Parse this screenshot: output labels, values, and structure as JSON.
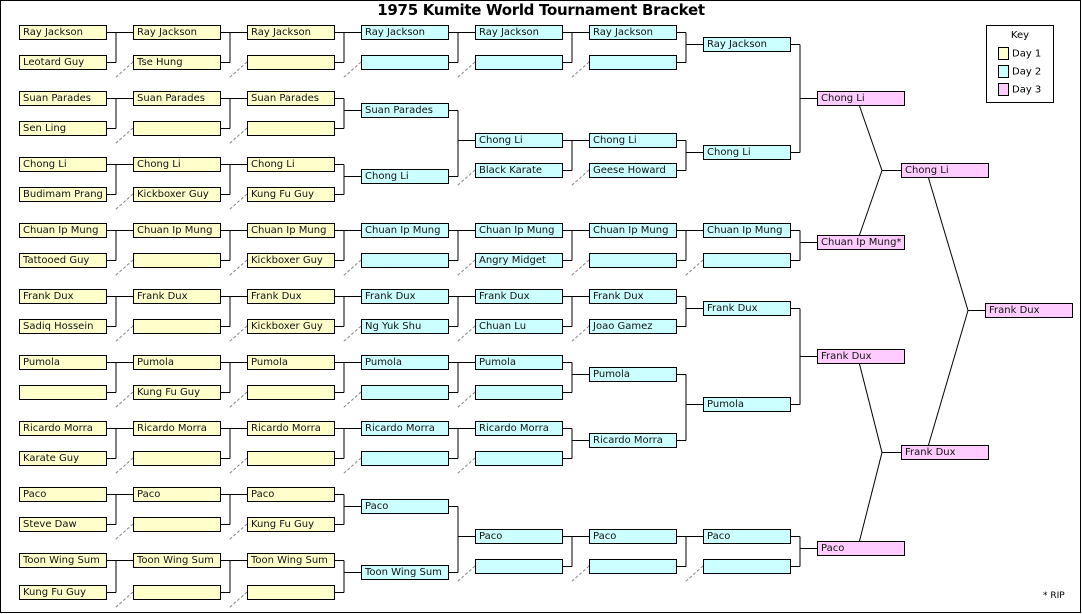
{
  "title": "1975 Kumite World Tournament Bracket",
  "colors": {
    "day1": "#ffffcc",
    "day2": "#ccffff",
    "day3": "#ffccff",
    "line": "#000000",
    "dashed": "#888888"
  },
  "key": {
    "title": "Key",
    "items": [
      {
        "label": "Day 1",
        "day": 1
      },
      {
        "label": "Day 2",
        "day": 2
      },
      {
        "label": "Day 3",
        "day": 3
      }
    ]
  },
  "footnote": "* RIP",
  "rounds": [
    [
      "Ray Jackson",
      "Leotard Guy",
      "Suan Parades",
      "Sen Ling",
      "Chong Li",
      "Budimam Prang",
      "Chuan Ip Mung",
      "Tattooed Guy",
      "Frank Dux",
      "Sadiq Hossein",
      "Pumola",
      "",
      "Ricardo Morra",
      "Karate Guy",
      "Paco",
      "Steve Daw",
      "Toon Wing Sum",
      "Kung Fu Guy"
    ],
    [
      "Ray Jackson",
      "Tse Hung",
      "Suan Parades",
      "",
      "Chong Li",
      "Kickboxer Guy",
      "Chuan Ip Mung",
      "",
      "Frank Dux",
      "",
      "Pumola",
      "Kung Fu Guy",
      "Ricardo Morra",
      "",
      "Paco",
      "",
      "Toon Wing Sum",
      ""
    ],
    [
      "Ray Jackson",
      "",
      "Suan Parades",
      "",
      "Chong Li",
      "Kung Fu Guy",
      "Chuan Ip Mung",
      "Kickboxer Guy",
      "Frank Dux",
      "Kickboxer Guy",
      "Pumola",
      "",
      "Ricardo Morra",
      "",
      "Paco",
      "Kung Fu Guy",
      "Toon Wing Sum",
      ""
    ],
    [
      "Ray Jackson",
      "",
      "Suan Parades",
      "Chong Li",
      "Chuan Ip Mung",
      "",
      "Frank Dux",
      "Ng Yuk Shu",
      "Pumola",
      "",
      "Ricardo Morra",
      "",
      "Paco",
      "Toon Wing Sum"
    ],
    [
      "Ray Jackson",
      "",
      "Chong Li",
      "Black Karate",
      "Chuan Ip Mung",
      "Angry Midget",
      "Frank Dux",
      "Chuan Lu",
      "Pumola",
      "",
      "Ricardo Morra",
      "",
      "Paco",
      ""
    ],
    [
      "Ray Jackson",
      "",
      "Chong Li",
      "Geese Howard",
      "Chuan Ip Mung",
      "",
      "Frank Dux",
      "Joao Gamez",
      "Pumola",
      "Ricardo Morra",
      "Paco",
      ""
    ],
    [
      "Ray Jackson",
      "Chong Li",
      "Chuan Ip Mung",
      "",
      "Frank Dux",
      "Pumola",
      "Paco",
      ""
    ],
    [
      "Chong Li",
      "Chuan Ip Mung*",
      "Frank Dux",
      "Paco"
    ],
    [
      "Chong Li",
      "Frank Dux"
    ],
    [
      "Frank Dux"
    ]
  ]
}
